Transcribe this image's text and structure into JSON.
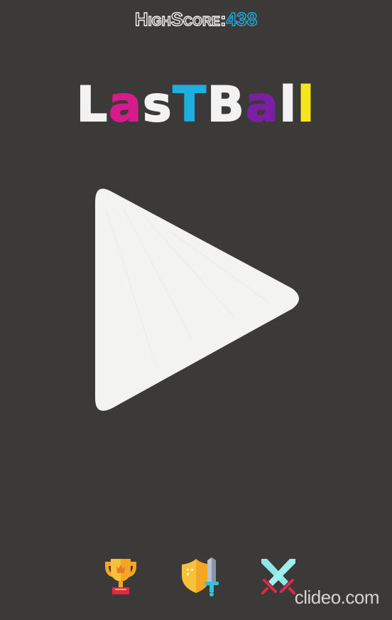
{
  "header": {
    "high_score_label": "HighScore:",
    "high_score_value": "438"
  },
  "title": {
    "letters": [
      {
        "char": "L",
        "color": "#f2f2f2"
      },
      {
        "char": "a",
        "color": "#d81b8a"
      },
      {
        "char": "s",
        "color": "#f2f2f2"
      },
      {
        "char": "T",
        "color": "#1eaee0"
      },
      {
        "char": "B",
        "color": "#f2f2f2"
      },
      {
        "char": "a",
        "color": "#7b1fa2"
      },
      {
        "char": "l",
        "color": "#f2f2f2"
      },
      {
        "char": "l",
        "color": "#f5e61e"
      }
    ]
  },
  "play_button": {
    "icon": "play-icon",
    "color": "#f3f3f1"
  },
  "bottom_bar": {
    "items": [
      {
        "name": "leaderboard-button",
        "icon": "trophy-icon"
      },
      {
        "name": "shop-button",
        "icon": "shield-sword-icon"
      },
      {
        "name": "battle-button",
        "icon": "crossed-swords-icon"
      }
    ]
  },
  "watermark": {
    "text": "clideo.com"
  },
  "colors": {
    "background": "#3b3a38",
    "accent_blue": "#1eaee0",
    "magenta": "#d81b8a",
    "purple": "#7b1fa2",
    "yellow": "#f5e61e"
  }
}
